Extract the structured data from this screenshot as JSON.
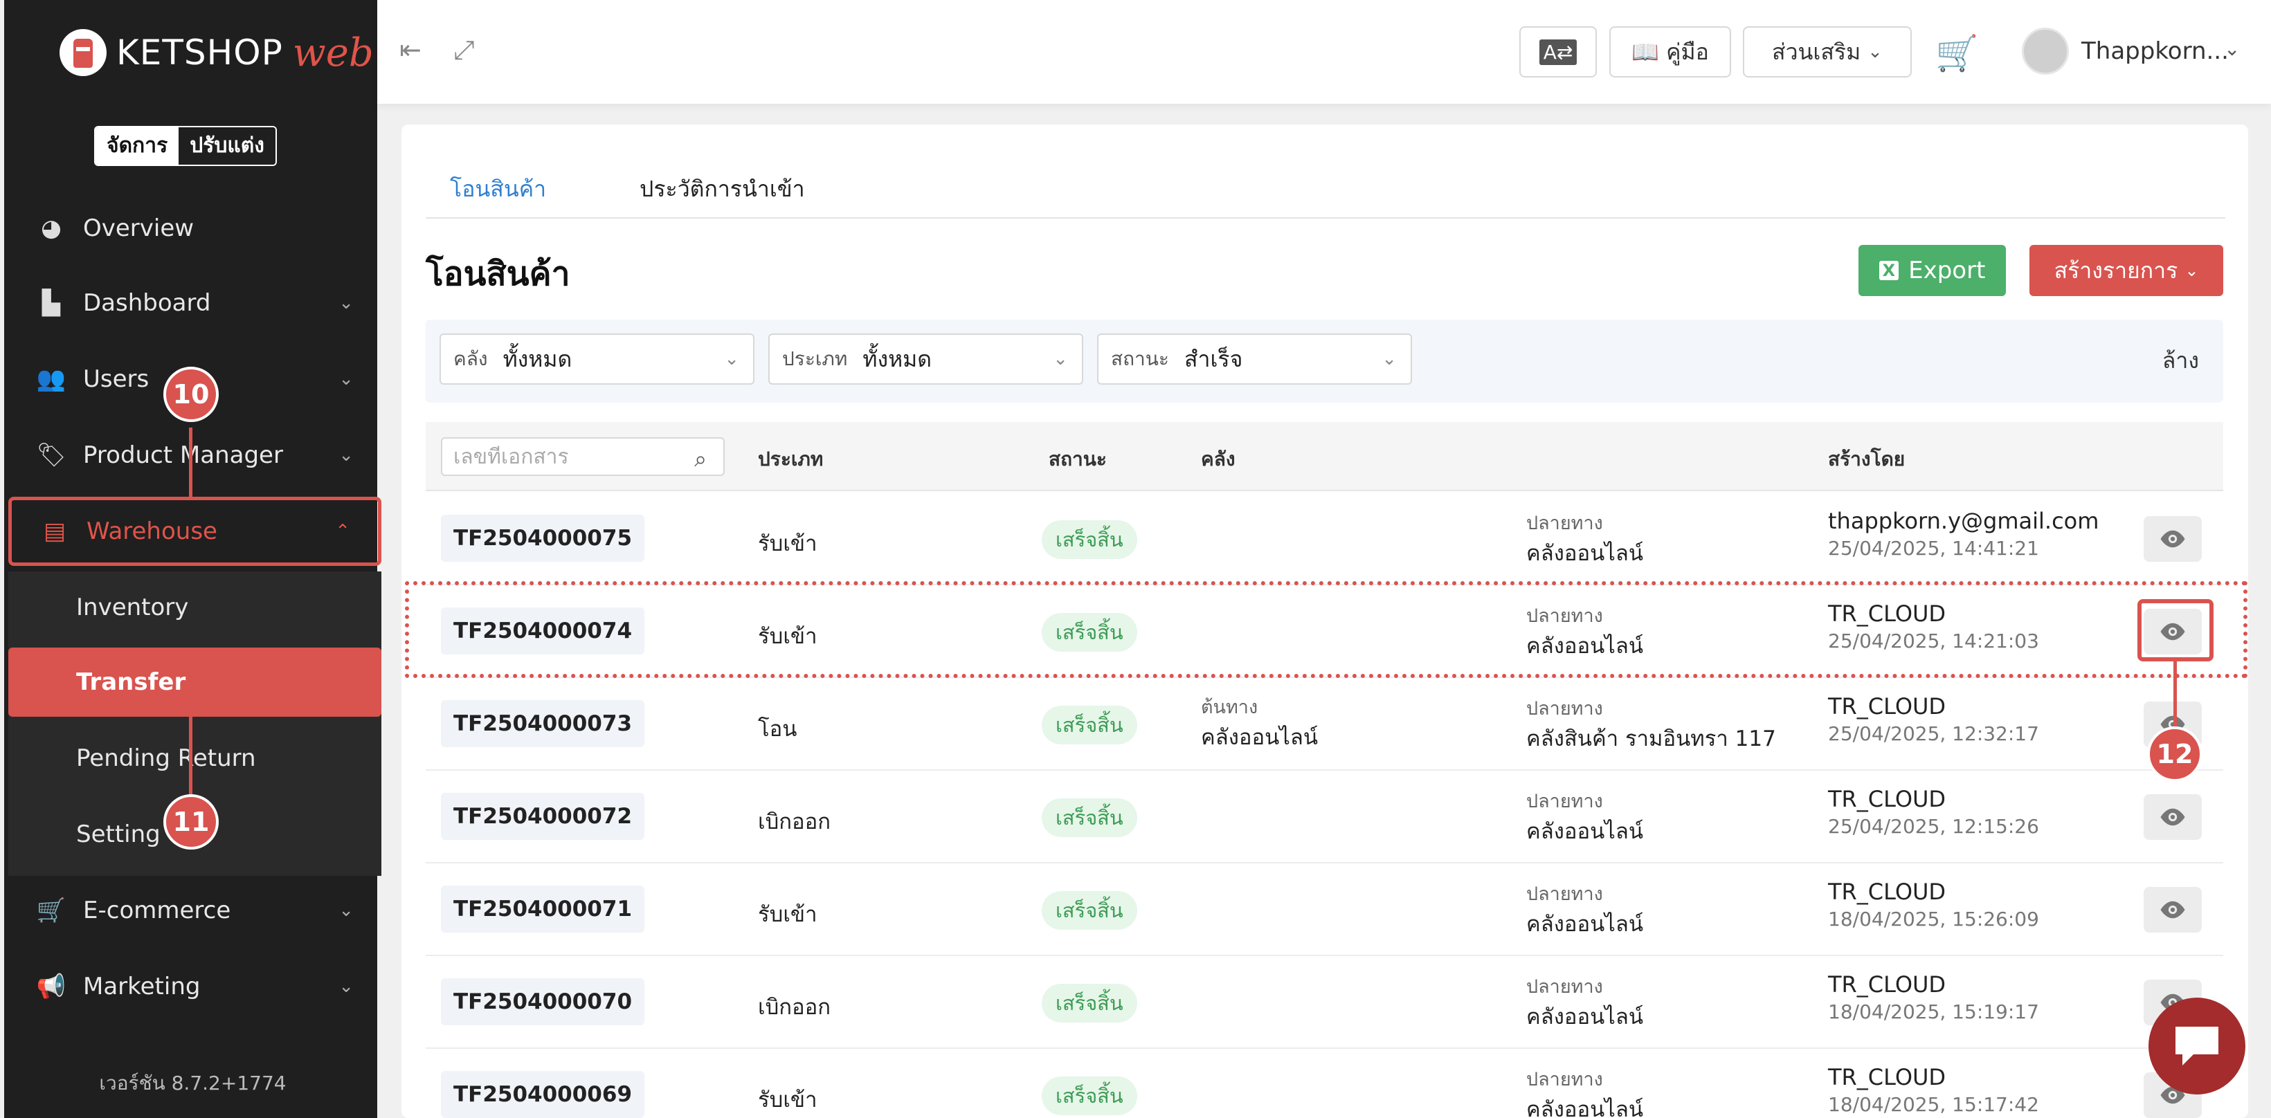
{
  "brand": {
    "name": "KETSHOP",
    "suffix": "web"
  },
  "mode_toggle": {
    "active": "จัดการ",
    "inactive": "ปรับแต่ง"
  },
  "sidebar": {
    "items": [
      {
        "label": "Overview",
        "icon": "pie-chart-icon"
      },
      {
        "label": "Dashboard",
        "icon": "bar-chart-icon"
      },
      {
        "label": "Users",
        "icon": "users-icon"
      },
      {
        "label": "Product Manager",
        "icon": "tag-icon"
      },
      {
        "label": "Warehouse",
        "icon": "warehouse-icon"
      },
      {
        "label": "E-commerce",
        "icon": "cart-icon"
      },
      {
        "label": "Marketing",
        "icon": "megaphone-icon"
      }
    ],
    "warehouse_sub": [
      {
        "label": "Inventory"
      },
      {
        "label": "Transfer"
      },
      {
        "label": "Pending Return"
      },
      {
        "label": "Setting"
      }
    ],
    "version": "เวอร์ชัน 8.7.2+1774"
  },
  "markers": {
    "m10": "10",
    "m11": "11",
    "m12": "12"
  },
  "topbar": {
    "manual_label": "คู่มือ",
    "addon_label": "ส่วนเสริม",
    "user_name": "Thappkorn..."
  },
  "tabs": [
    {
      "label": "โอนสินค้า",
      "active": true
    },
    {
      "label": "ประวัติการนำเข้า",
      "active": false
    }
  ],
  "page": {
    "title": "โอนสินค้า",
    "export_label": "Export",
    "create_label": "สร้างรายการ"
  },
  "filters": [
    {
      "label": "คลัง",
      "value": "ทั้งหมด"
    },
    {
      "label": "ประเภท",
      "value": "ทั้งหมด"
    },
    {
      "label": "สถานะ",
      "value": "สำเร็จ"
    }
  ],
  "clear_label": "ล้าง",
  "table": {
    "search_placeholder": "เลขที่เอกสาร",
    "headers": {
      "type": "ประเภท",
      "status": "สถานะ",
      "warehouse": "คลัง",
      "created_by": "สร้างโดย"
    },
    "rows": [
      {
        "doc": "TF2504000075",
        "type": "รับเข้า",
        "status": "เสร็จสิ้น",
        "src_label": "",
        "src": "",
        "dst_label": "ปลายทาง",
        "dst": "คลังออนไลน์",
        "creator": "thappkorn.y@gmail.com",
        "time": "25/04/2025, 14:41:21"
      },
      {
        "doc": "TF2504000074",
        "type": "รับเข้า",
        "status": "เสร็จสิ้น",
        "src_label": "",
        "src": "",
        "dst_label": "ปลายทาง",
        "dst": "คลังออนไลน์",
        "creator": "TR_CLOUD",
        "time": "25/04/2025, 14:21:03"
      },
      {
        "doc": "TF2504000073",
        "type": "โอน",
        "status": "เสร็จสิ้น",
        "src_label": "ต้นทาง",
        "src": "คลังออนไลน์",
        "dst_label": "ปลายทาง",
        "dst": "คลังสินค้า รามอินทรา 117",
        "creator": "TR_CLOUD",
        "time": "25/04/2025, 12:32:17"
      },
      {
        "doc": "TF2504000072",
        "type": "เบิกออก",
        "status": "เสร็จสิ้น",
        "src_label": "",
        "src": "",
        "dst_label": "ปลายทาง",
        "dst": "คลังออนไลน์",
        "creator": "TR_CLOUD",
        "time": "25/04/2025, 12:15:26"
      },
      {
        "doc": "TF2504000071",
        "type": "รับเข้า",
        "status": "เสร็จสิ้น",
        "src_label": "",
        "src": "",
        "dst_label": "ปลายทาง",
        "dst": "คลังออนไลน์",
        "creator": "TR_CLOUD",
        "time": "18/04/2025, 15:26:09"
      },
      {
        "doc": "TF2504000070",
        "type": "เบิกออก",
        "status": "เสร็จสิ้น",
        "src_label": "",
        "src": "",
        "dst_label": "ปลายทาง",
        "dst": "คลังออนไลน์",
        "creator": "TR_CLOUD",
        "time": "18/04/2025, 15:19:17"
      },
      {
        "doc": "TF2504000069",
        "type": "รับเข้า",
        "status": "เสร็จสิ้น",
        "src_label": "",
        "src": "",
        "dst_label": "ปลายทาง",
        "dst": "คลังออนไลน์",
        "creator": "TR_CLOUD",
        "time": "18/04/2025, 15:17:42"
      }
    ]
  },
  "colors": {
    "accent": "#d9534f",
    "success": "#4caf6a",
    "link": "#2f7fd0",
    "sidebar": "#1f1f1f"
  }
}
